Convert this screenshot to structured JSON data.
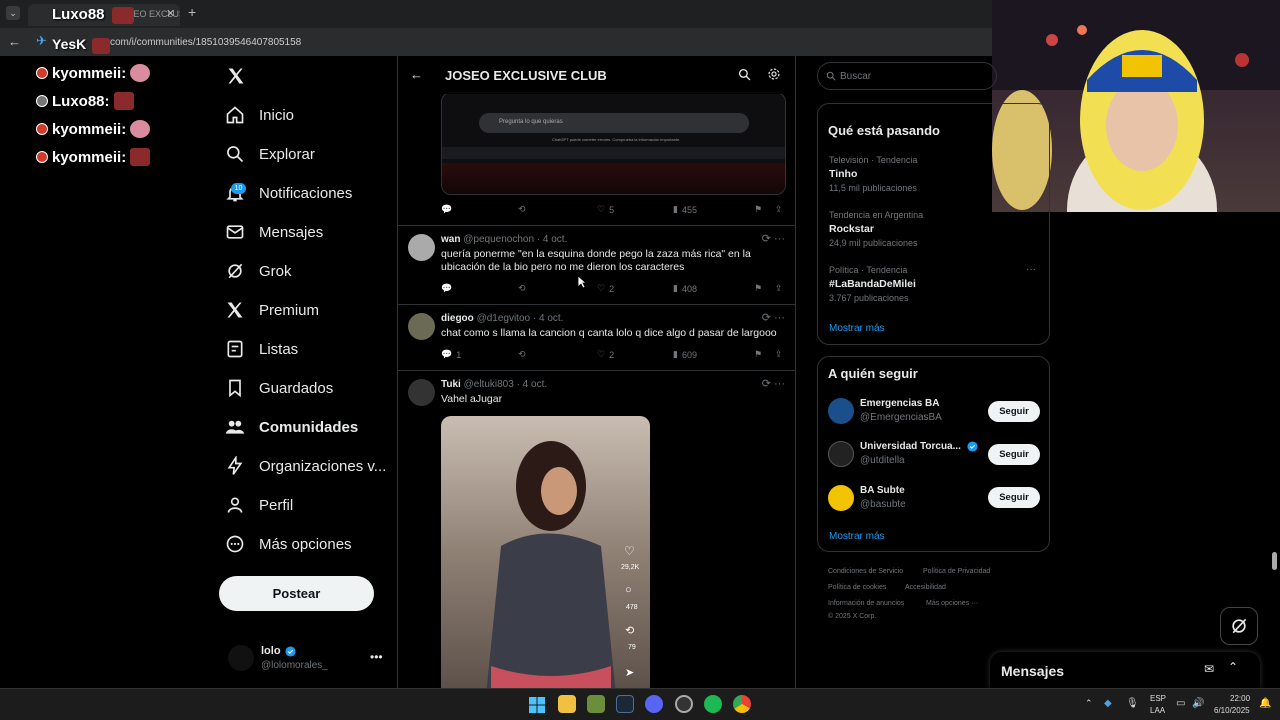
{
  "browser": {
    "tab_title": "Luxo88",
    "tab_suffix": "JOSEO EXCLUSIV",
    "url": "com/i/communities/1851039546407805158",
    "overlay_url_prefix": "YesK"
  },
  "stream_chat": [
    {
      "user": "kyommeii:",
      "dot": "red"
    },
    {
      "user": "Luxo88:",
      "dot": "grey"
    },
    {
      "user": "kyommeii:",
      "dot": "red"
    },
    {
      "user": "kyommeii:",
      "dot": "red"
    }
  ],
  "nav": {
    "items": [
      {
        "label": "Inicio",
        "icon": "home-icon"
      },
      {
        "label": "Explorar",
        "icon": "search-icon"
      },
      {
        "label": "Notificaciones",
        "icon": "bell-icon",
        "badge": "10"
      },
      {
        "label": "Mensajes",
        "icon": "mail-icon"
      },
      {
        "label": "Grok",
        "icon": "grok-icon"
      },
      {
        "label": "Premium",
        "icon": "x-logo-icon"
      },
      {
        "label": "Listas",
        "icon": "list-icon"
      },
      {
        "label": "Guardados",
        "icon": "bookmark-icon"
      },
      {
        "label": "Comunidades",
        "icon": "communities-icon"
      },
      {
        "label": "Organizaciones v...",
        "icon": "lightning-icon"
      },
      {
        "label": "Perfil",
        "icon": "person-icon"
      },
      {
        "label": "Más opciones",
        "icon": "more-circle-icon"
      }
    ],
    "post_button": "Postear",
    "account": {
      "name": "lolo",
      "handle": "@lolomorales_"
    }
  },
  "feed": {
    "header_title": "JOSEO EXCLUSIVE CLUB",
    "embedded_image": {
      "placeholder": "Pregunta lo que quieras",
      "disclaimer": "ChatGPT puede cometer errores. Comprueba la información importante."
    },
    "first_tweet_actions": {
      "likes": "5",
      "views": "455"
    },
    "tweets": [
      {
        "name": "wan",
        "handle": "@pequenochon",
        "date": "· 4 oct.",
        "text": "quería ponerme \"en la esquina donde pego la zaza más rica\" en la ubicación de la bio pero no me dieron los caracteres",
        "replies": "",
        "likes": "2",
        "views": "408"
      },
      {
        "name": "diegoo",
        "handle": "@d1egvitoo",
        "date": "· 4 oct.",
        "text": "chat como s llama la cancion q canta lolo q dice algo d pasar de largooo",
        "replies": "1",
        "likes": "2",
        "views": "609"
      },
      {
        "name": "Tuki",
        "handle": "@eltuki803",
        "date": "· 4 oct.",
        "text": "Vahel aJugar",
        "video_stats": {
          "likes": "29,2K",
          "comments": "478",
          "reposts": "79"
        }
      }
    ]
  },
  "right": {
    "search_placeholder": "Buscar",
    "trends_title": "Qué está pasando",
    "trends": [
      {
        "meta": "Televisión · Tendencia",
        "name": "Tinho",
        "count": "11,5 mil publicaciones"
      },
      {
        "meta": "Tendencia en Argentina",
        "name": "Rockstar",
        "count": "24,9 mil publicaciones"
      },
      {
        "meta": "Política · Tendencia",
        "name": "#LaBandaDeMilei",
        "count": "3.767 publicaciones"
      }
    ],
    "show_more": "Mostrar más",
    "follow_title": "A quién seguir",
    "follow": [
      {
        "name": "Emergencias BA",
        "handle": "@EmergenciasBA",
        "button": "Seguir",
        "color": "#1a4f8b"
      },
      {
        "name": "Universidad Torcua...",
        "handle": "@utditella",
        "button": "Seguir",
        "color": "#222222"
      },
      {
        "name": "BA Subte",
        "handle": "@basubte",
        "button": "Seguir",
        "color": "#f2c300"
      }
    ],
    "footer": [
      "Condiciones de Servicio",
      "Política de Privacidad",
      "Política de cookies",
      "Accesibilidad",
      "Información de anuncios",
      "Más opciones ···",
      "© 2025 X Corp."
    ],
    "messages_drawer": "Mensajes"
  },
  "taskbar": {
    "lang": "ESP",
    "lang2": "LAA",
    "time": "22:00",
    "date": "6/10/2025"
  },
  "colors": {
    "accent": "#1d9bf0",
    "bg": "#000000",
    "border": "#2f3336"
  }
}
